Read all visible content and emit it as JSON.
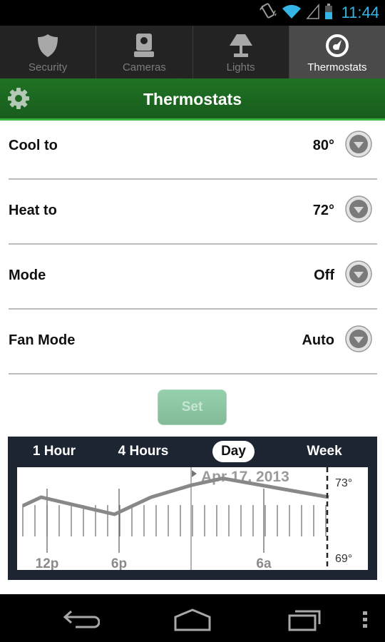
{
  "status_bar": {
    "time": "11:44",
    "icons": [
      "vibrate-icon",
      "wifi-icon",
      "cell-signal-icon",
      "battery-icon"
    ]
  },
  "tabs": [
    {
      "label": "Security",
      "icon": "shield-icon",
      "active": false
    },
    {
      "label": "Cameras",
      "icon": "camera-icon",
      "active": false
    },
    {
      "label": "Lights",
      "icon": "lamp-icon",
      "active": false
    },
    {
      "label": "Thermostats",
      "icon": "thermostat-dial-icon",
      "active": true
    }
  ],
  "header": {
    "title": "Thermostats",
    "settings_icon": "gear-icon",
    "accent_color": "#1f7324"
  },
  "settings": [
    {
      "label": "Cool to",
      "value": "80°"
    },
    {
      "label": "Heat to",
      "value": "72°"
    },
    {
      "label": "Mode",
      "value": "Off"
    },
    {
      "label": "Fan Mode",
      "value": "Auto"
    }
  ],
  "set_button": {
    "label": "Set",
    "enabled": false
  },
  "range_tabs": [
    {
      "label": "1 Hour",
      "active": false
    },
    {
      "label": "4 Hours",
      "active": false
    },
    {
      "label": "Day",
      "active": true
    },
    {
      "label": "Week",
      "active": false
    }
  ],
  "chart_data": {
    "type": "line",
    "title": "Apr 17, 2013",
    "x_tick_labels": [
      "12p",
      "6p",
      "6a"
    ],
    "y_tick_labels": [
      "73°",
      "69°"
    ],
    "ylim": [
      69,
      73
    ],
    "series": [
      {
        "name": "Temperature",
        "values": [
          72.0,
          72.5,
          71.5,
          72.5,
          73.2,
          73.6,
          72.5
        ]
      }
    ],
    "x_hours_from_start": [
      0,
      1,
      5,
      7,
      9.2,
      10.9,
      16.7
    ],
    "grid": true,
    "now_marker": true
  },
  "nav_bar": {
    "buttons": [
      "back-icon",
      "home-icon",
      "recent-apps-icon",
      "overflow-menu-icon"
    ]
  }
}
